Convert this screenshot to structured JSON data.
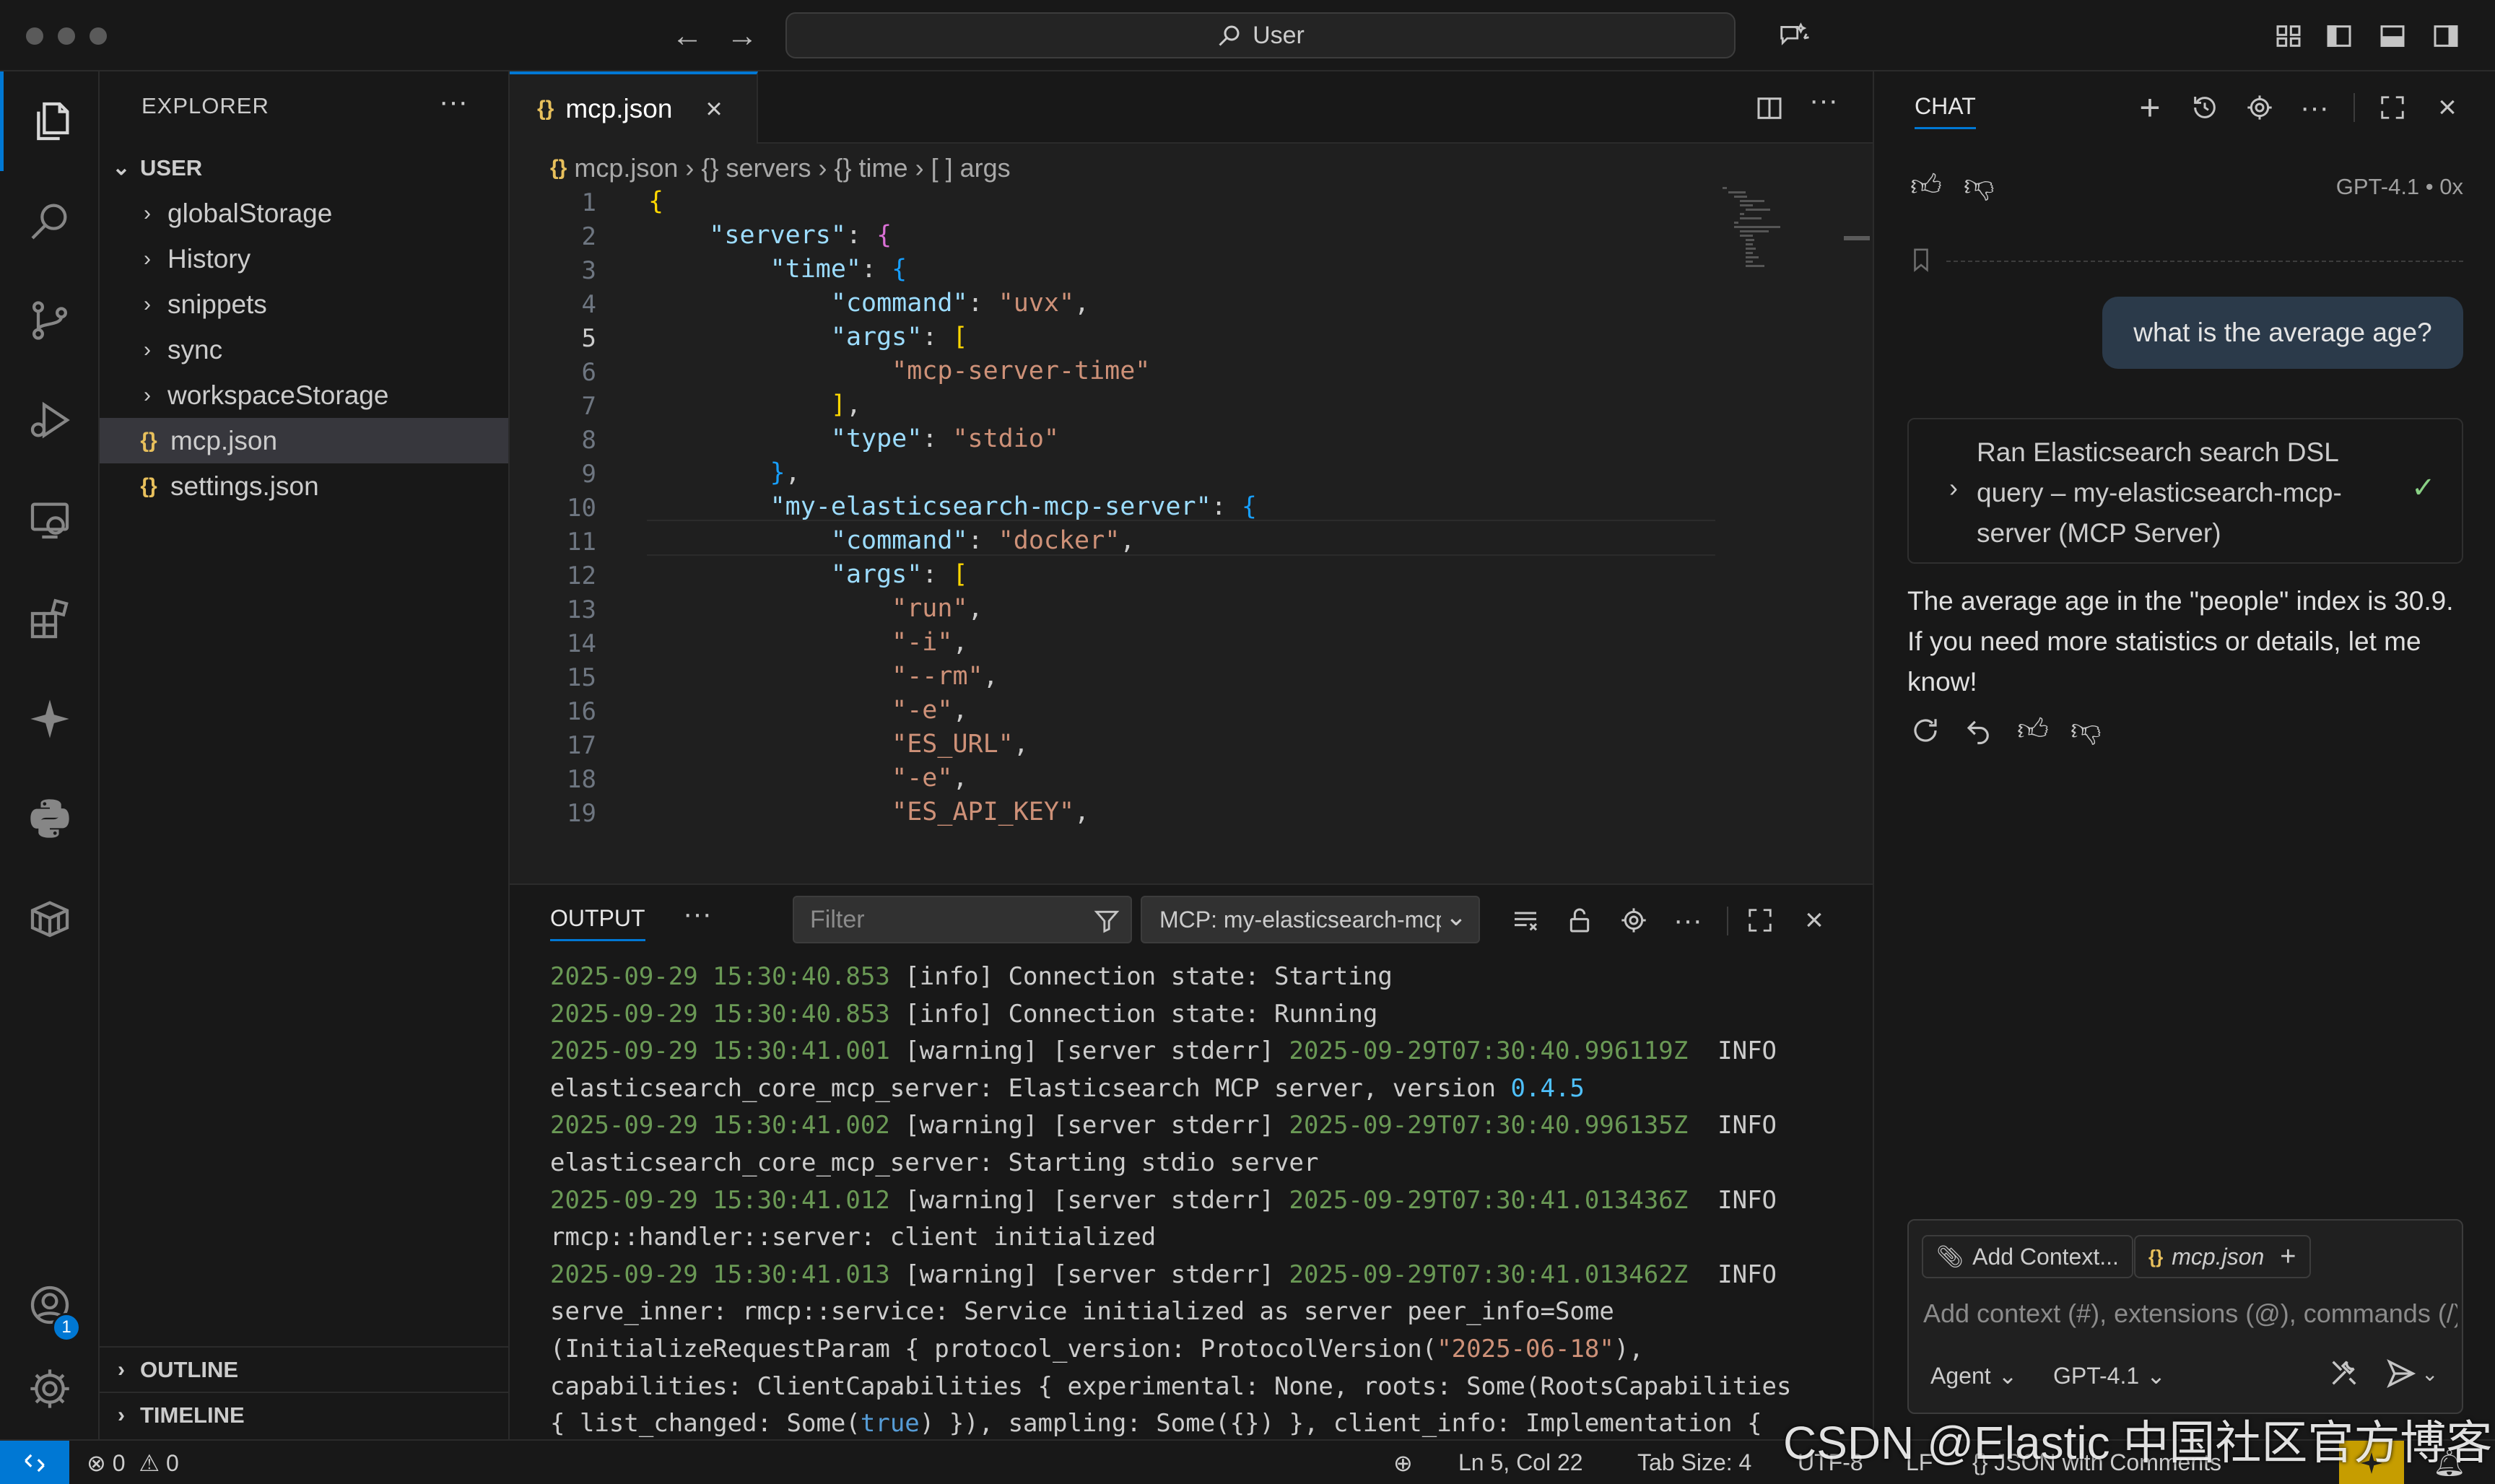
{
  "titlebar": {
    "command_center": "User"
  },
  "explorer": {
    "title": "EXPLORER",
    "more": "···",
    "root": "USER",
    "items": [
      {
        "label": "globalStorage",
        "type": "folder"
      },
      {
        "label": "History",
        "type": "folder"
      },
      {
        "label": "snippets",
        "type": "folder"
      },
      {
        "label": "sync",
        "type": "folder"
      },
      {
        "label": "workspaceStorage",
        "type": "folder"
      },
      {
        "label": "mcp.json",
        "type": "json",
        "selected": true
      },
      {
        "label": "settings.json",
        "type": "json"
      }
    ],
    "json_glyph": "{}",
    "outline": "OUTLINE",
    "timeline": "TIMELINE"
  },
  "editor": {
    "tab_label": "mcp.json",
    "breadcrumb": [
      "mcp.json",
      "servers",
      "time",
      "args"
    ],
    "breadcrumb_glyphs": [
      "{}",
      "{}",
      "{}",
      "[ ]"
    ],
    "cursor_line": 5,
    "line_numbers": [
      "1",
      "2",
      "3",
      "4",
      "5",
      "6",
      "7",
      "8",
      "9",
      "10",
      "11",
      "12",
      "13",
      "14",
      "15",
      "16",
      "17",
      "18",
      "19"
    ],
    "code_lines": [
      "{",
      "    \"servers\": {",
      "        \"time\": {",
      "            \"command\": \"uvx\",",
      "            \"args\": [",
      "                \"mcp-server-time\"",
      "            ],",
      "            \"type\": \"stdio\"",
      "        },",
      "        \"my-elasticsearch-mcp-server\": {",
      "            \"command\": \"docker\",",
      "            \"args\": [",
      "                \"run\",",
      "                \"-i\",",
      "                \"--rm\",",
      "                \"-e\",",
      "                \"ES_URL\",",
      "                \"-e\",",
      "                \"ES_API_KEY\","
    ]
  },
  "panel": {
    "tab": "OUTPUT",
    "more": "···",
    "filter_placeholder": "Filter",
    "channel": "MCP: my-elasticsearch-mcp-server",
    "log": [
      {
        "ts": "2025-09-29 15:30:40.853",
        "level": "[info]",
        "msg": "Connection state: Starting"
      },
      {
        "ts": "2025-09-29 15:30:40.853",
        "level": "[info]",
        "msg": "Connection state: Running"
      },
      {
        "ts": "2025-09-29 15:30:41.001",
        "level": "[warning]",
        "msg": "[server stderr]",
        "iso": "2025-09-29T07:30:40.996119Z",
        "lvl2": "INFO"
      },
      {
        "plain": "elasticsearch_core_mcp_server: Elasticsearch MCP server, version ",
        "num": "0.4.5"
      },
      {
        "ts": "2025-09-29 15:30:41.002",
        "level": "[warning]",
        "msg": "[server stderr]",
        "iso": "2025-09-29T07:30:40.996135Z",
        "lvl2": "INFO"
      },
      {
        "plain": "elasticsearch_core_mcp_server: Starting stdio server"
      },
      {
        "ts": "2025-09-29 15:30:41.012",
        "level": "[warning]",
        "msg": "[server stderr]",
        "iso": "2025-09-29T07:30:41.013436Z",
        "lvl2": "INFO"
      },
      {
        "plain": "rmcp::handler::server: client initialized"
      },
      {
        "ts": "2025-09-29 15:30:41.013",
        "level": "[warning]",
        "msg": "[server stderr]",
        "iso": "2025-09-29T07:30:41.013462Z",
        "lvl2": "INFO"
      },
      {
        "plain": "serve_inner: rmcp::service: Service initialized as server peer_info=Some"
      },
      {
        "plain": "(InitializeRequestParam { protocol_version: ProtocolVersion(",
        "str": "\"2025-06-18\"",
        "after": "),"
      },
      {
        "plain": "capabilities: ClientCapabilities { experimental: None, roots: Some(RootsCapabilities"
      },
      {
        "plain": "{ list_changed: Some(",
        "kw": "true",
        "after": ") }), sampling: Some({}) }, client_info: Implementation {"
      }
    ]
  },
  "chat": {
    "title": "CHAT",
    "model_info": "GPT-4.1 • 0x",
    "user_message": "what is the average age?",
    "tool_call": "Ran Elasticsearch search DSL query – my-elasticsearch-mcp-server (MCP Server)",
    "answer": "The average age in the \"people\" index is 30.9. If you need more statistics or details, let me know!",
    "add_context": "Add Context...",
    "context_file": "mcp.json",
    "input_placeholder": "Add context (#), extensions (@), commands (/)",
    "mode": "Agent",
    "model": "GPT-4.1"
  },
  "statusbar": {
    "errors": "0",
    "warnings": "0",
    "position": "Ln 5, Col 22",
    "tab_size": "Tab Size: 4",
    "encoding": "UTF-8",
    "eol": "LF",
    "language": "JSON with Comments",
    "watermark": "CSDN @Elastic 中国社区官方博客"
  },
  "colors": {
    "accent": "#0078d4",
    "json_icon": "#e8c05c",
    "string": "#ce9178",
    "property": "#9cdcfe",
    "log_timestamp": "#6a9955"
  }
}
